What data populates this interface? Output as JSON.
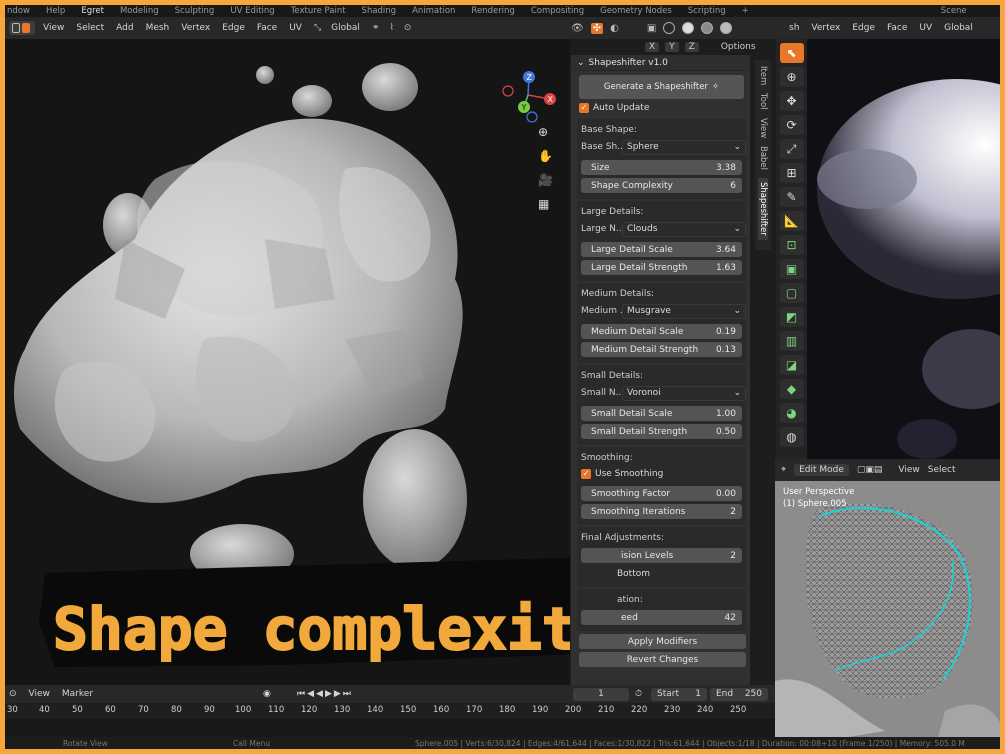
{
  "top_tabs": [
    "ndow",
    "Help",
    "Egret",
    "Modeling",
    "Sculpting",
    "UV Editing",
    "Texture Paint",
    "Shading",
    "Animation",
    "Rendering",
    "Compositing",
    "Geometry Nodes",
    "Scripting",
    "+",
    "Scene"
  ],
  "viewport_header": {
    "menus": [
      "View",
      "Select",
      "Add",
      "Mesh",
      "Vertex",
      "Edge",
      "Face",
      "UV"
    ],
    "transform": "Global"
  },
  "options_row": {
    "axes": [
      "X",
      "Y",
      "Z"
    ],
    "options": "Options"
  },
  "gizmo": {
    "x": "X",
    "y": "Y",
    "z": "Z"
  },
  "panel": {
    "title": "Shapeshifter v1.0",
    "generate": "Generate a Shapeshifter",
    "auto_update": "Auto Update",
    "base": {
      "label": "Base Shape:",
      "select_label": "Base Sh...",
      "select_value": "Sphere",
      "fields": [
        {
          "label": "Size",
          "value": "3.38"
        },
        {
          "label": "Shape Complexity",
          "value": "6"
        }
      ]
    },
    "large": {
      "label": "Large Details:",
      "select_label": "Large N...",
      "select_value": "Clouds",
      "fields": [
        {
          "label": "Large Detail Scale",
          "value": "3.64"
        },
        {
          "label": "Large Detail Strength",
          "value": "1.63"
        }
      ]
    },
    "medium": {
      "label": "Medium Details:",
      "select_label": "Medium ...",
      "select_value": "Musgrave",
      "fields": [
        {
          "label": "Medium Detail Scale",
          "value": "0.19"
        },
        {
          "label": "Medium Detail Strength",
          "value": "0.13"
        }
      ]
    },
    "small": {
      "label": "Small Details:",
      "select_label": "Small N...",
      "select_value": "Voronoi",
      "fields": [
        {
          "label": "Small Detail Scale",
          "value": "1.00"
        },
        {
          "label": "Small Detail Strength",
          "value": "0.50"
        }
      ]
    },
    "smoothing": {
      "label": "Smoothing:",
      "use": "Use Smoothing",
      "fields": [
        {
          "label": "Smoothing Factor",
          "value": "0.00"
        },
        {
          "label": "Smoothing Iterations",
          "value": "2"
        }
      ]
    },
    "final": {
      "label": "Final Adjustments:",
      "levels_label": "ision Levels",
      "levels_value": "2",
      "bottom": "Bottom",
      "ation": "ation:",
      "seed_label": "eed",
      "seed_value": "42"
    },
    "apply": "Apply Modifiers",
    "revert": "Revert Changes"
  },
  "vtabs": [
    "Item",
    "Tool",
    "View",
    "Babel",
    "Shapeshifter"
  ],
  "right_header": [
    "sh",
    "Vertex",
    "Edge",
    "Face",
    "UV",
    "Global"
  ],
  "edit": {
    "mode": "Edit Mode",
    "view": "View",
    "select": "Select",
    "perspective": "User Perspective",
    "object": "(1) Sphere.005"
  },
  "timeline": {
    "view": "View",
    "marker": "Marker",
    "current": "1",
    "start_label": "Start",
    "start": "1",
    "end_label": "End",
    "end": "250",
    "ticks": [
      "30",
      "40",
      "50",
      "60",
      "70",
      "80",
      "90",
      "100",
      "110",
      "120",
      "130",
      "140",
      "150",
      "160",
      "170",
      "180",
      "190",
      "200",
      "210",
      "220",
      "230",
      "240",
      "250"
    ]
  },
  "status": {
    "rotate": "Rotate View",
    "menu": "Call Menu",
    "stats": "Sphere.005 | Verts:6/30,824 | Edges:4/61,644 | Faces:1/30,822 | Tris:61,644 | Objects:1/18 | Duration: 00:08+10 (Frame 1/250) | Memory: 505.0 M"
  },
  "banner": {
    "text": "Shape complexity!"
  },
  "colors": {
    "accent": "#e9772a",
    "banner_fill": "#f2a93b",
    "frame": "#f7a63b"
  }
}
